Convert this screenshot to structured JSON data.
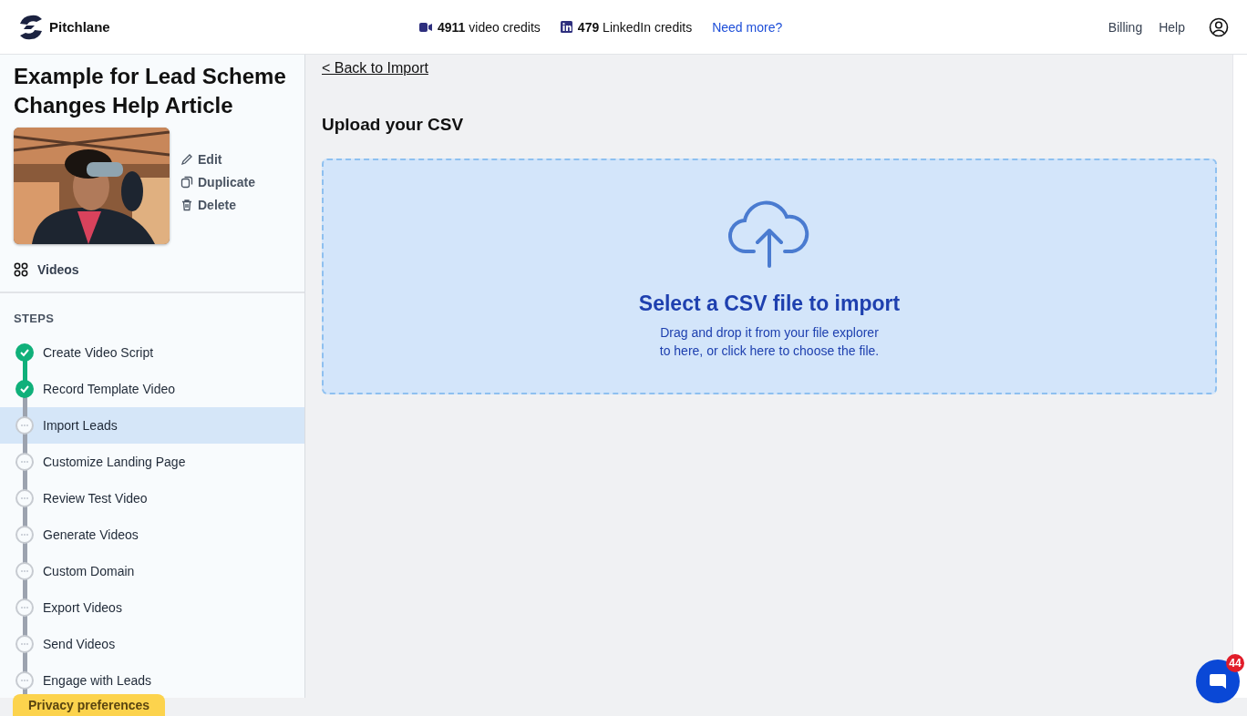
{
  "header": {
    "brand": "Pitchlane",
    "credits": [
      {
        "kind": "video",
        "count": "4911",
        "label": "video credits"
      },
      {
        "kind": "linkedin",
        "count": "479",
        "label": "LinkedIn credits"
      }
    ],
    "need_more": "Need more?",
    "nav": [
      "Billing",
      "Help"
    ]
  },
  "sidebar": {
    "title": "Example for Lead Scheme Changes Help Article",
    "actions": [
      {
        "kind": "edit",
        "label": "Edit"
      },
      {
        "kind": "duplicate",
        "label": "Duplicate"
      },
      {
        "kind": "delete",
        "label": "Delete"
      }
    ],
    "videos_link": "Videos",
    "steps_heading": "STEPS",
    "steps": [
      {
        "label": "Create Video Script",
        "done": true,
        "selected": false
      },
      {
        "label": "Record Template Video",
        "done": true,
        "selected": false
      },
      {
        "label": "Import Leads",
        "done": false,
        "selected": true
      },
      {
        "label": "Customize Landing Page",
        "done": false,
        "selected": false
      },
      {
        "label": "Review Test Video",
        "done": false,
        "selected": false
      },
      {
        "label": "Generate Videos",
        "done": false,
        "selected": false
      },
      {
        "label": "Custom Domain",
        "done": false,
        "selected": false
      },
      {
        "label": "Export Videos",
        "done": false,
        "selected": false
      },
      {
        "label": "Send Videos",
        "done": false,
        "selected": false
      },
      {
        "label": "Engage with Leads",
        "done": false,
        "selected": false
      }
    ]
  },
  "main": {
    "back_link": "< Back to Import",
    "heading": "Upload your CSV",
    "dropzone": {
      "title": "Select a CSV file to import",
      "hint_lines": [
        "Drag and drop it from your file explorer",
        "to here, or click here to choose the file."
      ]
    }
  },
  "privacy_button": "Privacy preferences",
  "chat": {
    "badge": "44"
  }
}
